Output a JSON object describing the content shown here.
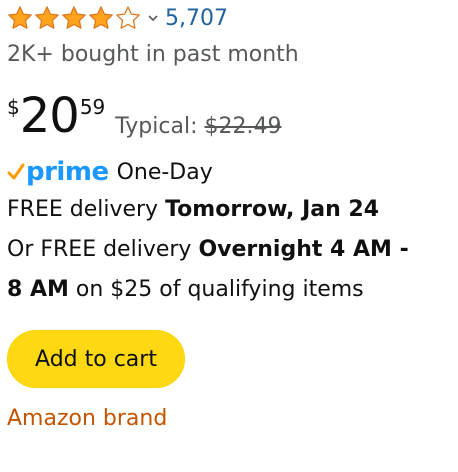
{
  "rating": {
    "value": 4.5,
    "max": 5,
    "count": "5,707",
    "star_color": "#ffa41c",
    "star_outline": "#de7921",
    "icons": [
      "star-full-icon",
      "star-full-icon",
      "star-full-icon",
      "star-full-icon",
      "star-empty-icon",
      "chevron-down-icon"
    ]
  },
  "bought": "2K+ bought in past month",
  "price": {
    "symbol": "$",
    "whole": "20",
    "fraction": "59",
    "typical_label": "Typical:",
    "typical_value": "$22.49"
  },
  "prime": {
    "check": "✓",
    "label": "prime",
    "one_day": "One-Day",
    "color": "#1a98ff",
    "check_color": "#ff9900"
  },
  "delivery": {
    "line1_prefix": "FREE delivery ",
    "line1_date": "Tomorrow, Jan 24",
    "line2_prefix": "Or FREE delivery ",
    "line2_window": "Overnight 4 AM -",
    "line3_window": "8 AM",
    "line3_suffix": " on $25 of qualifying items"
  },
  "cart_button": {
    "label": "Add to cart",
    "color": "#ffd814"
  },
  "brand": {
    "label": "Amazon brand",
    "color": "#c45500"
  }
}
